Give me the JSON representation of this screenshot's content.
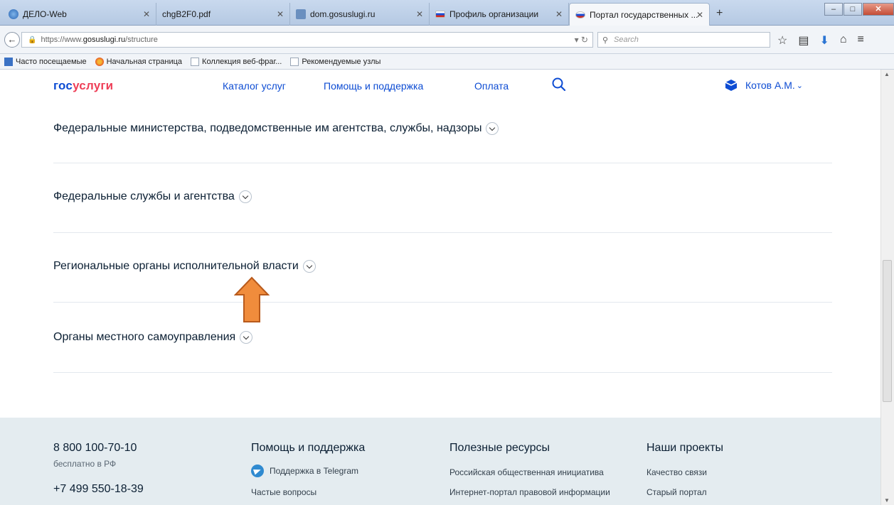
{
  "browser": {
    "tabs": [
      {
        "label": "ДЕЛО-Web",
        "favicon": "ie-icon"
      },
      {
        "label": "chgB2F0.pdf",
        "favicon": "none"
      },
      {
        "label": "dom.gosuslugi.ru",
        "favicon": "building-icon"
      },
      {
        "label": "Профиль организации",
        "favicon": "russia-flag-icon"
      },
      {
        "label": "Портал государственных ...",
        "favicon": "russia-flag-icon"
      }
    ],
    "url_prefix": "https://www.",
    "url_domain": "gosuslugi.ru",
    "url_path": "/structure",
    "search_placeholder": "Search",
    "bookmarks": [
      {
        "label": "Часто посещаемые",
        "icon": "most-visited-icon"
      },
      {
        "label": "Начальная страница",
        "icon": "firefox-icon"
      },
      {
        "label": "Коллекция веб-фраг...",
        "icon": "page-icon"
      },
      {
        "label": "Рекомендуемые узлы",
        "icon": "page-icon"
      }
    ]
  },
  "site": {
    "logo_part1": "гос",
    "logo_part2": "услуги",
    "nav": [
      "Каталог услуг",
      "Помощь и поддержка",
      "Оплата"
    ],
    "user_name": "Котов А.М.",
    "brand_color": "#0d4cd3",
    "logo_accent": "#ee3f58"
  },
  "sections": [
    {
      "title": "Федеральные министерства, подведомственные им агентства, службы, надзоры"
    },
    {
      "title": "Федеральные службы и агентства"
    },
    {
      "title": "Региональные органы исполнительной власти"
    },
    {
      "title": "Органы местного самоуправления"
    }
  ],
  "annotation": {
    "arrow_color": "#e8853b"
  },
  "footer": {
    "phone1": "8 800 100-70-10",
    "phone1_note": "бесплатно в РФ",
    "phone2": "+7 499 550-18-39",
    "help_title": "Помощь и поддержка",
    "help_links": [
      "Поддержка в Telegram",
      "Частые вопросы"
    ],
    "resources_title": "Полезные ресурсы",
    "resources_links": [
      "Российская общественная инициатива",
      "Интернет-портал правовой информации"
    ],
    "projects_title": "Наши проекты",
    "projects_links": [
      "Качество связи",
      "Старый портал"
    ]
  }
}
